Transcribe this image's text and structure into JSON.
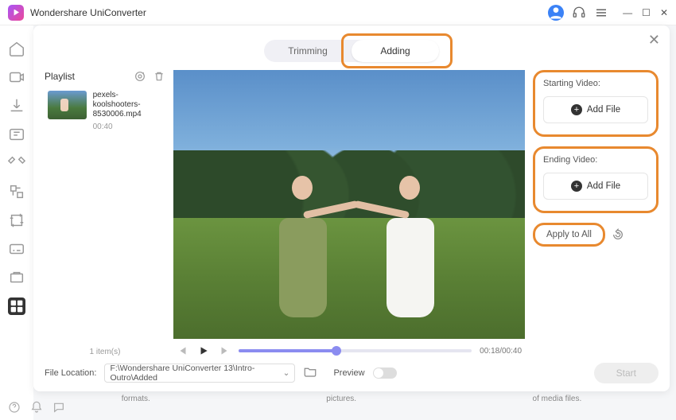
{
  "app": {
    "title": "Wondershare UniConverter"
  },
  "tabs": {
    "trimming": "Trimming",
    "adding": "Adding"
  },
  "playlist": {
    "title": "Playlist",
    "items": [
      {
        "name": "pexels-koolshooters-8530006.mp4",
        "duration": "00:40"
      }
    ],
    "count": "1 item(s)"
  },
  "playback": {
    "time": "00:18/00:40"
  },
  "right": {
    "starting": "Starting Video:",
    "ending": "Ending Video:",
    "add_file": "Add File",
    "apply": "Apply to All"
  },
  "footer": {
    "location_label": "File Location:",
    "path": "F:\\Wondershare UniConverter 13\\Intro-Outro\\Added",
    "preview_label": "Preview",
    "start": "Start"
  },
  "peek": {
    "a": "formats.",
    "b": "pictures.",
    "c": "of media files."
  }
}
